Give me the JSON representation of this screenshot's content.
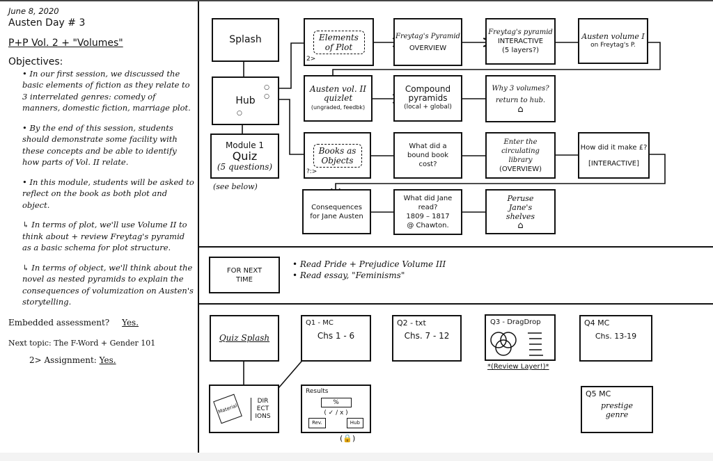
{
  "notes": {
    "date": "June 8, 2020",
    "day": "Austen Day # 3",
    "topic": "P+P Vol. 2 + \"Volumes\"",
    "objectives_label": "Objectives:",
    "objectives": [
      "• In our first session, we discussed the basic elements of fiction as they relate to 3 interrelated genres: comedy of manners, domestic fiction, marriage plot.",
      "• By the end of this session, students should demonstrate some facility with these concepts and be able to identify how parts of Vol. II relate.",
      "• In this module, students will be asked to reflect on the book as both plot and object.",
      "↳ In terms of plot, we'll use Volume II to think about + review Freytag's pyramid as a basic schema for plot structure.",
      "↳ In terms of object, we'll think about the novel as nested pyramids to explain the consequences of volumization on Austen's storytelling."
    ],
    "embedded_label": "Embedded assessment?",
    "embedded_value": "Yes.",
    "next_topic": "Next topic: The F-Word + Gender 101",
    "assignment_label": "2> Assignment:",
    "assignment_value": "Yes."
  },
  "flow": {
    "splash": "Splash",
    "hub": "Hub",
    "quiz": {
      "line1": "Module 1",
      "line2": "Quiz",
      "line3": "(5 questions)",
      "note": "(see below)"
    },
    "elements": {
      "title": "Elements of Plot",
      "corner": "2>"
    },
    "freytag_overview": {
      "title": "Freytag's Pyramid",
      "sub": "OVERVIEW"
    },
    "freytag_interactive": {
      "title": "Freytag's pyramid",
      "sub": "INTERACTIVE",
      "note": "(5 layers?)"
    },
    "austen_vol1": {
      "title": "Austen volume I",
      "sub": "on Freytag's P."
    },
    "quizlet": {
      "title": "Austen vol. II quizlet",
      "sub": "(ungraded, feedbk)"
    },
    "compound": {
      "title": "Compound pyramids",
      "sub": "(local + global)"
    },
    "why3": {
      "title": "Why 3 volumes?",
      "sub": "return to hub."
    },
    "books": {
      "title": "Books as Objects",
      "corner": "?:>"
    },
    "cost": {
      "title": "What did a bound book cost?"
    },
    "library": {
      "title": "Enter the circulating library",
      "sub": "(OVERVIEW)"
    },
    "make": {
      "title": "How did it make £?",
      "sub": "[INTERACTIVE]"
    },
    "consequences": {
      "title": "Consequences for Jane Austen"
    },
    "jane_read": {
      "title": "What did Jane read?",
      "years": "1809 – 1817",
      "struck": "1809",
      "place": "@ Chawton."
    },
    "peruse": {
      "title": "Peruse Jane's shelves"
    }
  },
  "next_time": {
    "label": "FOR NEXT TIME",
    "items": [
      "• Read Pride + Prejudice Volume III",
      "• Read essay, \"Feminisms\""
    ]
  },
  "quiz_flow": {
    "splash": "Quiz Splash",
    "q1": {
      "title": "Q1 - MC",
      "sub": "Chs 1 - 6"
    },
    "q2": {
      "title": "Q2 - txt",
      "sub": "Chs. 7 - 12"
    },
    "q3": {
      "title": "Q3 - DragDrop",
      "note": "*(Review Layer!)*"
    },
    "q4": {
      "title": "Q4 MC",
      "sub": "Chs. 13-19"
    },
    "q5": {
      "title": "Q5 MC",
      "sub": "prestige genre"
    },
    "directions": {
      "material": "Material",
      "text": "DIR ECT IONS"
    },
    "results": {
      "title": "Results",
      "pct": "%",
      "marks": "( ✓ / x )",
      "btn1": "Rev.",
      "btn2": "Hub",
      "lock": "(🔒)"
    }
  }
}
